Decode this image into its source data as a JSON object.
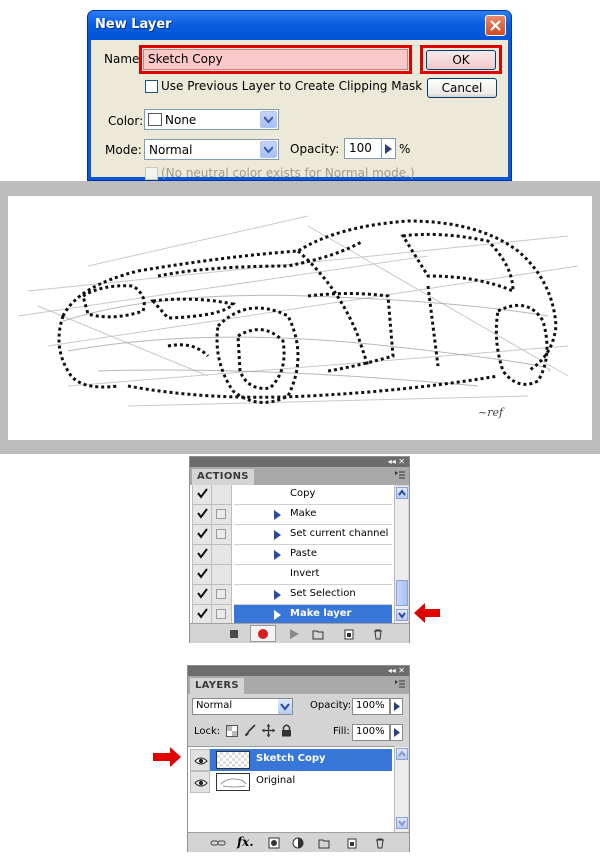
{
  "dialog": {
    "title": "New Layer",
    "name_label": "Name:",
    "name_value": "Sketch Copy",
    "ok_label": "OK",
    "cancel_label": "Cancel",
    "clipping_mask_label": "Use Previous Layer to Create Clipping Mask",
    "color_label": "Color:",
    "color_value": "None",
    "mode_label": "Mode:",
    "mode_value": "Normal",
    "opacity_label": "Opacity:",
    "opacity_value": "100",
    "opacity_unit": "%",
    "neutral_color_label": "(No neutral color exists for Normal mode.)"
  },
  "sketch": {
    "signature": "~ref"
  },
  "actions_panel": {
    "tab_label": "ACTIONS",
    "panel_controls": "◂◂ ✕",
    "items": [
      {
        "label": "Copy",
        "expandable": false,
        "dialog_box": false
      },
      {
        "label": "Make",
        "expandable": true,
        "dialog_box": true
      },
      {
        "label": "Set current channel",
        "expandable": true,
        "dialog_box": true
      },
      {
        "label": "Paste",
        "expandable": true,
        "dialog_box": false
      },
      {
        "label": "Invert",
        "expandable": false,
        "dialog_box": false
      },
      {
        "label": "Set Selection",
        "expandable": true,
        "dialog_box": true
      },
      {
        "label": "Make layer",
        "expandable": true,
        "dialog_box": true,
        "selected": true
      }
    ]
  },
  "layers_panel": {
    "tab_label": "LAYERS",
    "panel_controls": "◂◂ ✕",
    "blend_mode": "Normal",
    "opacity_label": "Opacity:",
    "opacity_value": "100%",
    "lock_label": "Lock:",
    "fill_label": "Fill:",
    "fill_value": "100%",
    "layers": [
      {
        "name": "Sketch Copy",
        "selected": true
      },
      {
        "name": "Original",
        "selected": false
      }
    ],
    "fx_label": "fx."
  },
  "colors": {
    "xp_title_blue": "#0a58d8",
    "highlight_red": "#e00000",
    "selection_blue": "#3876d8",
    "name_field_fill": "#f9c8c8"
  }
}
